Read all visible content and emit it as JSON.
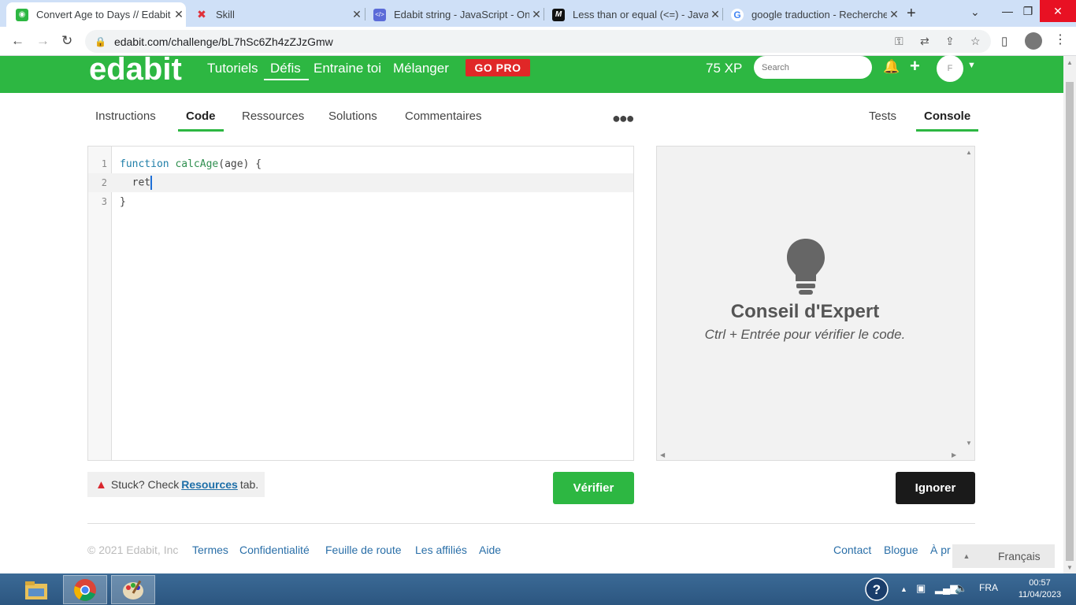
{
  "browser": {
    "tabs": [
      {
        "title": "Convert Age to Days // Edabit",
        "active": true
      },
      {
        "title": "Skill",
        "active": false
      },
      {
        "title": "Edabit string - JavaScript - One",
        "active": false
      },
      {
        "title": "Less than or equal (<=) - JavaS",
        "active": false
      },
      {
        "title": "google traduction - Recherche",
        "active": false
      }
    ],
    "url": "edabit.com/challenge/bL7hSc6Zh4zZJzGmw"
  },
  "edabit": {
    "logo": "edabit",
    "nav": [
      "Tutoriels",
      "Défis",
      "Entraine toi",
      "Mélanger"
    ],
    "gopro": "GO PRO",
    "xp": "75 XP",
    "search_placeholder": "Search",
    "avatar_initials": "F"
  },
  "subtabs": {
    "left": [
      "Instructions",
      "Code",
      "Ressources",
      "Solutions",
      "Commentaires"
    ],
    "right": [
      "Tests",
      "Console"
    ]
  },
  "editor": {
    "line_numbers": [
      "1",
      "2",
      "3"
    ],
    "line1_kw": "function",
    "line1_fn": "calcAge",
    "line1_rest": "(age) {",
    "line2": "  ret",
    "line3": "}"
  },
  "console": {
    "tip_title": "Conseil d'Expert",
    "tip_text": "Ctrl + Entrée pour vérifier le code."
  },
  "actions": {
    "stuck_prefix": "Stuck? Check",
    "stuck_link": "Resources",
    "stuck_suffix": "tab.",
    "verify": "Vérifier",
    "ignore": "Ignorer"
  },
  "footer": {
    "copyright": "© 2021 Edabit, Inc",
    "links_left": [
      "Termes",
      "Confidentialité",
      "Feuille de route",
      "Les affiliés",
      "Aide"
    ],
    "links_right": [
      "Contact",
      "Blogue",
      "À pr"
    ],
    "language": "Français"
  },
  "taskbar": {
    "lang": "FRA",
    "time": "00:57",
    "date": "11/04/2023"
  },
  "colors": {
    "brand_green": "#2db742",
    "gopro_red": "#e02727"
  }
}
